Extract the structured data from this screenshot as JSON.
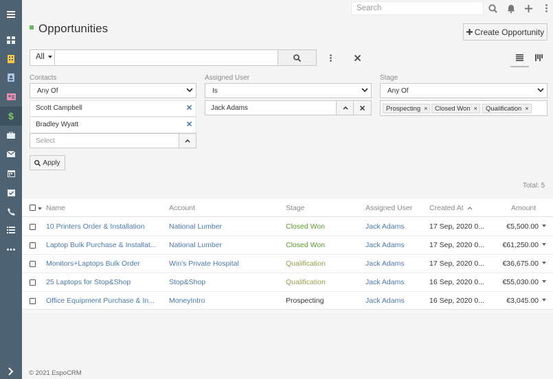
{
  "topbar": {
    "search_placeholder": "Search"
  },
  "sidebar": {
    "items": [
      {
        "icon": "menu-icon"
      },
      {
        "icon": "dashboard-icon"
      },
      {
        "icon": "accounts-icon"
      },
      {
        "icon": "contacts-icon"
      },
      {
        "icon": "leads-icon"
      },
      {
        "icon": "opportunities-icon"
      },
      {
        "icon": "cases-icon"
      },
      {
        "icon": "email-icon"
      },
      {
        "icon": "calendar-icon"
      },
      {
        "icon": "meetings-icon"
      },
      {
        "icon": "calls-icon"
      },
      {
        "icon": "tasks-icon"
      },
      {
        "icon": "more-icon"
      },
      {
        "icon": "expand-icon"
      }
    ]
  },
  "header": {
    "title": "Opportunities",
    "create_button": "Create Opportunity"
  },
  "search": {
    "scope": "All",
    "text": ""
  },
  "filters": {
    "contacts": {
      "label": "Contacts",
      "operator": "Any Of",
      "values": [
        "Scott Campbell",
        "Bradley Wyatt"
      ],
      "select_placeholder": "Select"
    },
    "assigned_user": {
      "label": "Assigned User",
      "operator": "Is",
      "value": "Jack Adams"
    },
    "stage": {
      "label": "Stage",
      "operator": "Any Of",
      "values": [
        "Prospecting",
        "Closed Won",
        "Qualification"
      ]
    },
    "apply_label": "Apply"
  },
  "total_label": "Total: 5",
  "table": {
    "columns": [
      "Name",
      "Account",
      "Stage",
      "Assigned User",
      "Created At",
      "Amount"
    ],
    "rows": [
      {
        "name": "10 Printers Order & Installation",
        "account": "National Lumber",
        "stage": "Closed Won",
        "stage_class": "st-won",
        "assigned": "Jack Adams",
        "created": "17 Sep, 2020 0...",
        "amount": "€5,500.00"
      },
      {
        "name": "Laptop Bulk Purchase & Installat...",
        "account": "National Lumber",
        "stage": "Closed Won",
        "stage_class": "st-won",
        "assigned": "Jack Adams",
        "created": "17 Sep, 2020 0...",
        "amount": "€61,250.00"
      },
      {
        "name": "Monitors+Laptops Bulk Order",
        "account": "Win's Private Hospital",
        "stage": "Qualification",
        "stage_class": "st-qual",
        "assigned": "Jack Adams",
        "created": "17 Sep, 2020 0...",
        "amount": "€36,675.00"
      },
      {
        "name": "25 Laptops for Stop&Shop",
        "account": "Stop&Shop",
        "stage": "Qualification",
        "stage_class": "st-qual",
        "assigned": "Jack Adams",
        "created": "16 Sep, 2020 0...",
        "amount": "€55,030.00"
      },
      {
        "name": "Office Equipment Purchase & In...",
        "account": "MoneyIntro",
        "stage": "Prospecting",
        "stage_class": "st-pro",
        "assigned": "Jack Adams",
        "created": "16 Sep, 2020 0...",
        "amount": "€3,045.00"
      }
    ]
  },
  "footer": "© 2021 EspoCRM",
  "colors": {
    "sidebar": "#4e6271",
    "active_accent": "#6fb25f",
    "link": "#4b79a8",
    "won": "#5c9a2b",
    "qualification": "#9a9a4d"
  }
}
